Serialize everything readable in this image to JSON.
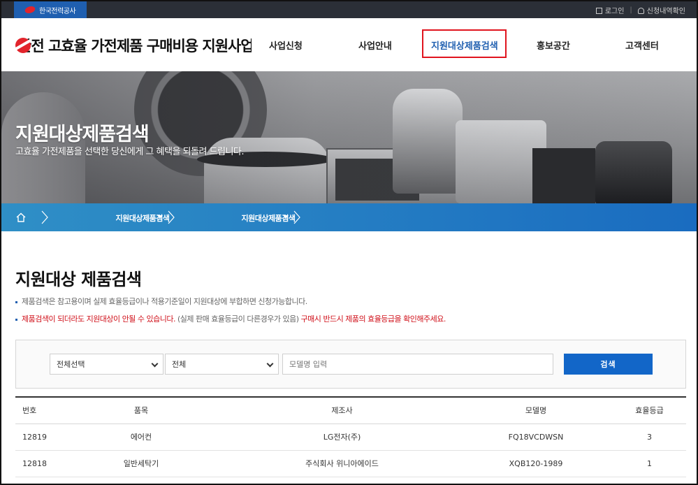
{
  "topbar": {
    "org_name": "한국전력공사",
    "login": "로그인",
    "application_check": "신청내역확인"
  },
  "header": {
    "site_title": "한전 고효율 가전제품 구매비용 지원사업",
    "menu": [
      {
        "label": "사업신청"
      },
      {
        "label": "사업안내"
      },
      {
        "label": "지원대상제품검색"
      },
      {
        "label": "홍보공간"
      },
      {
        "label": "고객센터"
      }
    ],
    "active_index": 2
  },
  "hero": {
    "title": "지원대상제품검색",
    "subtitle": "고효율 가전제품을 선택한 당신에게 그 혜택을 되돌려 드립니다."
  },
  "breadcrumb": {
    "level1": "지원대상제품검색",
    "level2": "지원대상제품검색"
  },
  "content": {
    "title": "지원대상 제품검색",
    "notice1": "제품검색은 참고용이며 실제 효율등급이나 적용기준일이 지원대상에 부합하면 신청가능합니다.",
    "notice2_red1": "제품검색이 되더라도 지원대상이 안될 수 있습니다.",
    "notice2_gray": "(실제 판매 효율등급이 다른경우가 있음)",
    "notice2_red2": "구매시 반드시 제품의 효율등급을 확인해주세요."
  },
  "search": {
    "category_selected": "전체선택",
    "maker_selected": "전체",
    "model_placeholder": "모델명 입력",
    "button_label": "검색"
  },
  "table": {
    "headers": {
      "no": "번호",
      "item": "품목",
      "maker": "제조사",
      "model": "모델명",
      "grade": "효율등급"
    },
    "rows": [
      {
        "no": "12819",
        "item": "에어컨",
        "maker": "LG전자(주)",
        "model": "FQ18VCDWSN",
        "grade": "3"
      },
      {
        "no": "12818",
        "item": "일반세탁기",
        "maker": "주식회사 위니아에이드",
        "model": "XQB120-1989",
        "grade": "1"
      }
    ]
  },
  "colors": {
    "accent_blue": "#1f5fb0",
    "button_blue": "#1266c8",
    "alert_red": "#d0101a",
    "highlight_box": "#e0141e"
  }
}
